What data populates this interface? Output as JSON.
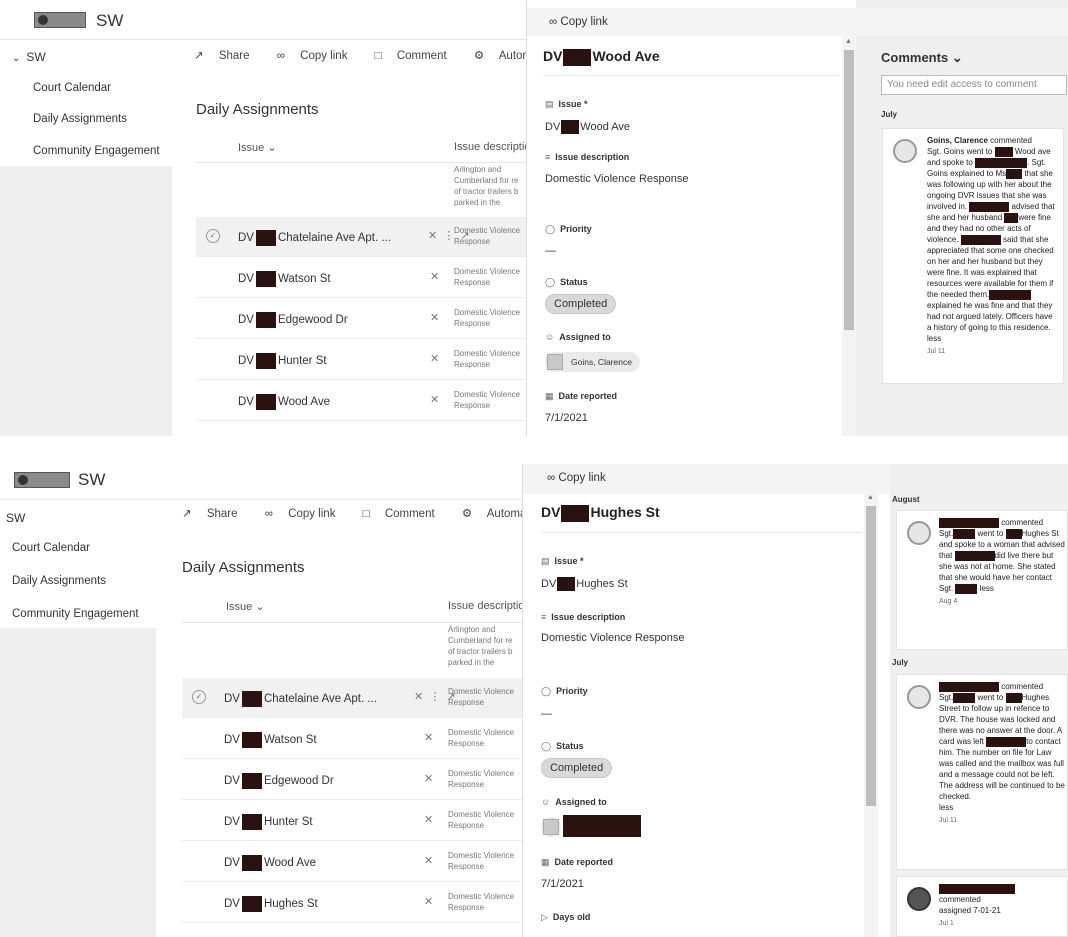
{
  "site": {
    "name": "SW"
  },
  "nav": {
    "root": "SW",
    "items": [
      "Court Calendar",
      "Daily Assignments",
      "Community Engagement"
    ]
  },
  "commands": {
    "share": "Share",
    "copy_link": "Copy link",
    "comment": "Comment",
    "automate": "Automate",
    "more": "···"
  },
  "list": {
    "title": "Daily Assignments",
    "col_issue": "Issue",
    "col_desc": "Issue descriptio",
    "pre_desc": "Arlington and Cumberland for re of tractor trailers b parked in the",
    "row_desc": "Domestic Violence Response",
    "dv_prefix": "DV",
    "rows_top": [
      {
        "title": "Chatelaine Ave Apt. ..."
      },
      {
        "title": "Watson St"
      },
      {
        "title": "Edgewood Dr"
      },
      {
        "title": "Hunter St"
      },
      {
        "title": "Wood Ave"
      }
    ],
    "rows_bottom": [
      {
        "title": "Chatelaine Ave Apt. ..."
      },
      {
        "title": "Watson St"
      },
      {
        "title": "Edgewood Dr"
      },
      {
        "title": "Hunter St"
      },
      {
        "title": "Wood Ave"
      },
      {
        "title": "Hughes St"
      }
    ]
  },
  "detail_top": {
    "copy_link": "Copy link",
    "title_prefix": "DV",
    "title_suffix": "Wood Ave",
    "issue_label": "Issue *",
    "issue_prefix": "DV",
    "issue_suffix": "Wood Ave",
    "desc_label": "Issue description",
    "desc_value": "Domestic Violence Response",
    "priority_label": "Priority",
    "priority_value": "—",
    "status_label": "Status",
    "status_value": "Completed",
    "assigned_label": "Assigned to",
    "assigned_value": "Goins, Clarence",
    "date_label": "Date reported",
    "date_value": "7/1/2021"
  },
  "detail_bottom": {
    "copy_link": "Copy link",
    "title_prefix": "DV",
    "title_suffix": "Hughes St",
    "issue_label": "Issue *",
    "issue_prefix": "DV",
    "issue_suffix": "Hughes St",
    "desc_label": "Issue description",
    "desc_value": "Domestic Violence Response",
    "priority_label": "Priority",
    "priority_value": "—",
    "status_label": "Status",
    "status_value": "Completed",
    "assigned_label": "Assigned to",
    "date_label": "Date reported",
    "date_value": "7/1/2021",
    "days_label": "Days old"
  },
  "comments_top": {
    "heading": "Comments",
    "input_placeholder": "You need edit access to comment",
    "month": "July",
    "author": "Goins, Clarence",
    "verb": "commented",
    "seg1": "Sgt. Goins went to",
    "seg2": "Wood ave and spoke to",
    "seg3": ". Sgt. Goins explained to Ms",
    "seg4": "that she was following up with her about the ongoing DVR issues that she was involved in.",
    "seg5": "advised that she and her husband",
    "seg6": "were fine and they had no other acts of violence.",
    "seg7": "said that she appreciated that some one checked on her and her husband but they were fine.  It was explained that resources were available for them if the needed them.",
    "seg8": "explained he was fine and that they had not argued lately.  Officers have a history of going to this residence.",
    "less": "less",
    "date": "Jul 11"
  },
  "comments_bottom": {
    "month1": "August",
    "c1_verb": "commented",
    "c1_seg1": "Sgt.",
    "c1_seg2": "went to",
    "c1_seg3": "Hughes St and spoke to a woman that advised that",
    "c1_seg4": "did live there but she was not at home.  She stated that she would have her contact Sgt.",
    "c1_less": "less",
    "c1_date": "Aug 4",
    "month2": "July",
    "c2_verb": "commented",
    "c2_seg1": "Sgt.",
    "c2_seg2": "went to",
    "c2_seg3": "Hughes Street to follow up in refence to DVR.  The house was locked and there was no answer at the door.  A card was left",
    "c2_seg4": "to contact him. The number on file for Law was called and the mailbox was full and a message could not be left. The address will be continued to be checked.",
    "c2_less": "less",
    "c2_date": "Jul 11",
    "c3_verb": "commented",
    "c3_text": "assigned 7-01-21",
    "c3_date": "Jul 1"
  }
}
